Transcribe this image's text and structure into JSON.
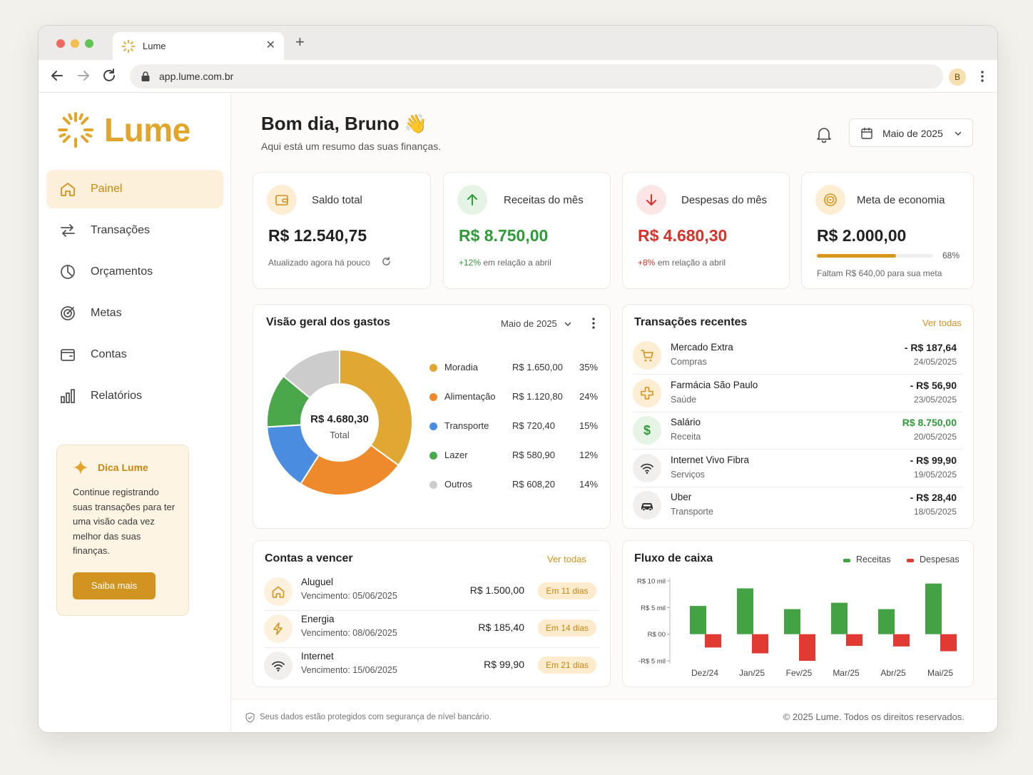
{
  "browser": {
    "tab_title": "Lume",
    "url": "app.lume.com.br",
    "profile_initial": "B"
  },
  "brand": {
    "name": "Lume",
    "accent": "#e1a52c"
  },
  "sidebar": {
    "items": [
      {
        "label": "Painel",
        "icon": "home-icon",
        "active": true
      },
      {
        "label": "Transações",
        "icon": "transfer-icon",
        "active": false
      },
      {
        "label": "Orçamentos",
        "icon": "pie-icon",
        "active": false
      },
      {
        "label": "Metas",
        "icon": "target-icon",
        "active": false
      },
      {
        "label": "Contas",
        "icon": "wallet-icon",
        "active": false
      },
      {
        "label": "Relatórios",
        "icon": "bar-chart-icon",
        "active": false
      }
    ],
    "tip": {
      "title": "Dica Lume",
      "body": "Continue registrando suas transações para ter uma visão cada vez melhor das suas finanças.",
      "button": "Saiba mais"
    }
  },
  "header": {
    "greeting": "Bom dia, Bruno 👋",
    "subtitle": "Aqui está um resumo das suas finanças.",
    "month_selector": "Maio de 2025"
  },
  "kpis": [
    {
      "label": "Saldo total",
      "value": "R$ 12.540,75",
      "note": "Atualizado agora há pouco"
    },
    {
      "label": "Receitas do mês",
      "value": "R$ 8.750,00",
      "change": "+12%",
      "note": "em relação a abril"
    },
    {
      "label": "Despesas do mês",
      "value": "R$ 4.680,30",
      "change": "+8%",
      "note": "em relação a abril"
    },
    {
      "label": "Meta de economia",
      "value": "R$ 2.000,00",
      "progress": 0.68,
      "progress_label": "68%",
      "note": "Faltam R$ 640,00 para sua meta"
    }
  ],
  "spending": {
    "title": "Visão geral dos gastos",
    "period": "Maio de 2025",
    "total_value": "R$ 4.680,30",
    "total_label": "Total",
    "categories": [
      {
        "name": "Moradia",
        "value": "R$ 1.650,00",
        "pct": "35%",
        "share": 35,
        "color": "#e0a832"
      },
      {
        "name": "Alimentação",
        "value": "R$ 1.120,80",
        "pct": "24%",
        "share": 24,
        "color": "#ef8a2c"
      },
      {
        "name": "Transporte",
        "value": "R$ 720,40",
        "pct": "15%",
        "share": 15,
        "color": "#4a8de0"
      },
      {
        "name": "Lazer",
        "value": "R$ 580,90",
        "pct": "12%",
        "share": 12,
        "color": "#4aa84b"
      },
      {
        "name": "Outros",
        "value": "R$ 608,20",
        "pct": "14%",
        "share": 14,
        "color": "#cccccc"
      }
    ]
  },
  "transactions": {
    "title": "Transações recentes",
    "link": "Ver todas",
    "items": [
      {
        "name": "Mercado Extra",
        "category": "Compras",
        "amount": "- R$ 187,64",
        "date": "24/05/2025",
        "type": "debit",
        "icon": "cart-icon"
      },
      {
        "name": "Farmácia São Paulo",
        "category": "Saúde",
        "amount": "- R$ 56,90",
        "date": "23/05/2025",
        "type": "debit",
        "icon": "medical-cross-icon"
      },
      {
        "name": "Salário",
        "category": "Receita",
        "amount": "R$ 8.750,00",
        "date": "20/05/2025",
        "type": "credit",
        "icon": "dollar-icon"
      },
      {
        "name": "Internet Vivo Fibra",
        "category": "Serviços",
        "amount": "- R$ 99,90",
        "date": "19/05/2025",
        "type": "debit",
        "icon": "wifi-icon"
      },
      {
        "name": "Uber",
        "category": "Transporte",
        "amount": "- R$ 28,40",
        "date": "18/05/2025",
        "type": "debit",
        "icon": "car-icon"
      }
    ]
  },
  "bills": {
    "title": "Contas a vencer",
    "link": "Ver todas",
    "items": [
      {
        "name": "Aluguel",
        "due": "Vencimento: 05/06/2025",
        "amount": "R$ 1.500,00",
        "badge": "Em 11 dias",
        "icon": "home-icon"
      },
      {
        "name": "Energia",
        "due": "Vencimento: 08/06/2025",
        "amount": "R$ 185,40",
        "badge": "Em 14 dias",
        "icon": "lightning-icon"
      },
      {
        "name": "Internet",
        "due": "Vencimento: 15/06/2025",
        "amount": "R$ 99,90",
        "badge": "Em 21 dias",
        "icon": "wifi-icon"
      }
    ]
  },
  "chart_data": {
    "type": "bar",
    "title": "Fluxo de caixa",
    "categories": [
      "Dez/24",
      "Jan/25",
      "Fev/25",
      "Mar/25",
      "Abr/25",
      "Mai/25"
    ],
    "series": [
      {
        "name": "Receitas",
        "color": "#43a344",
        "values": [
          5300,
          8600,
          4700,
          5900,
          4700,
          9500
        ]
      },
      {
        "name": "Despesas",
        "color": "#e03a33",
        "values": [
          -2500,
          -3600,
          -5000,
          -2200,
          -2300,
          -3200
        ]
      }
    ],
    "ytick_labels": [
      "R$ 10 mil",
      "R$ 5 mil",
      "R$ 00",
      "-R$ 5 mil"
    ],
    "yticks": [
      10000,
      5000,
      0,
      -5000
    ],
    "ylim": [
      -5000,
      10000
    ],
    "legend": "top-right",
    "grid": false
  },
  "footer": {
    "security": "Seus dados estão protegidos com segurança de nível bancário.",
    "copyright": "© 2025 Lume. Todos os direitos reservados."
  }
}
